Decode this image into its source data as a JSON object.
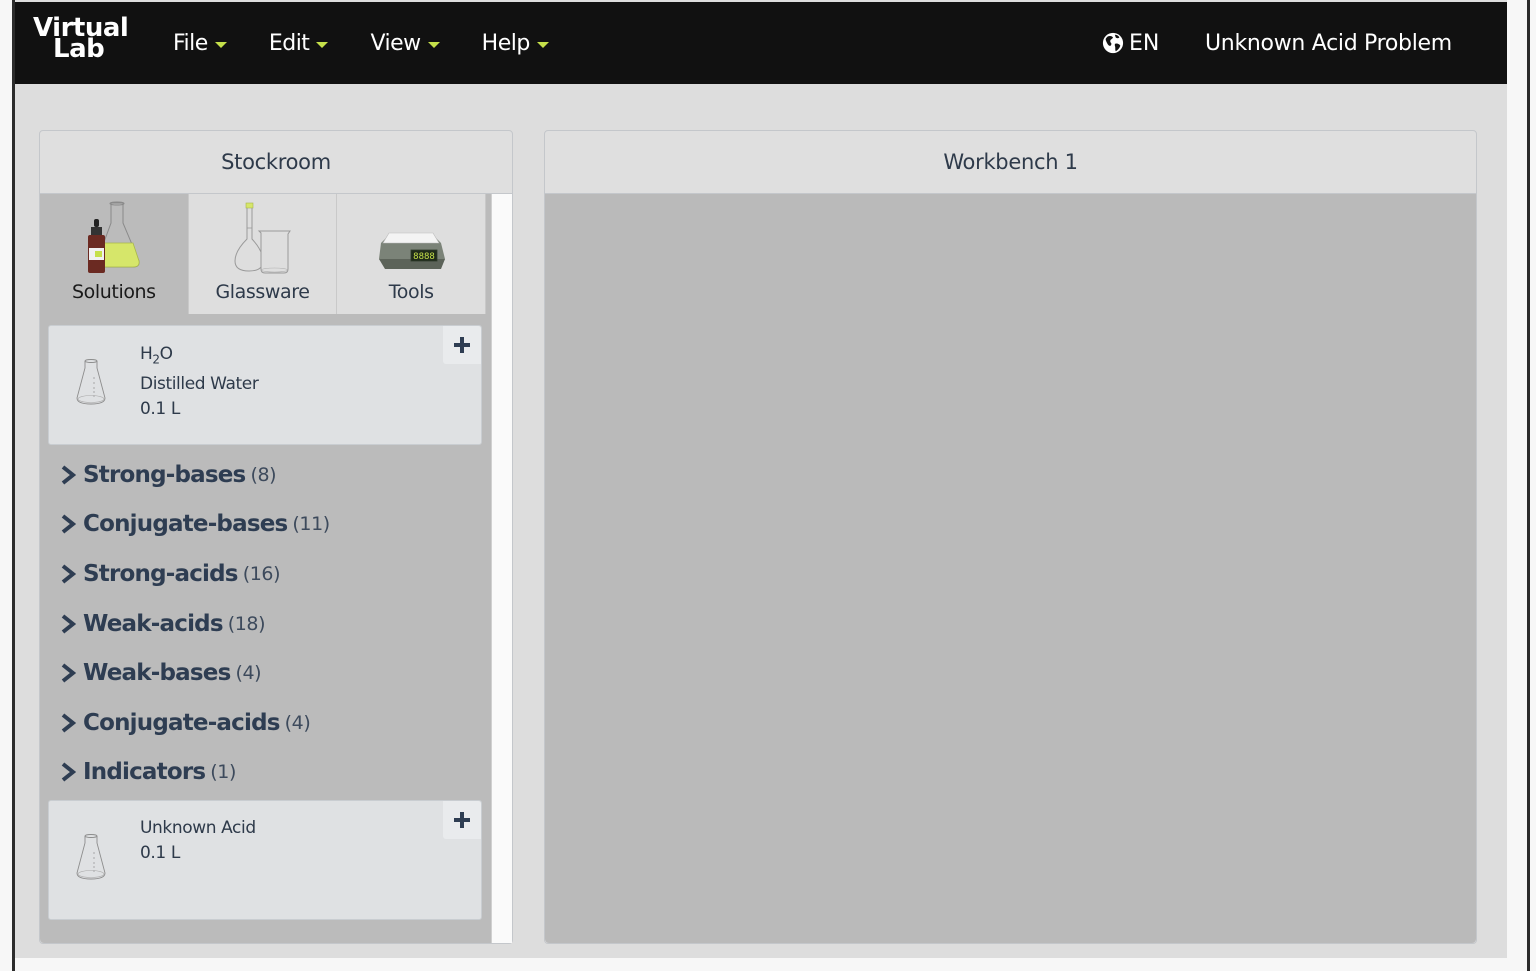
{
  "app": {
    "logo_line1": "Virtual",
    "logo_line2": "Lab",
    "menu": [
      {
        "label": "File"
      },
      {
        "label": "Edit"
      },
      {
        "label": "View"
      },
      {
        "label": "Help"
      }
    ],
    "language": "EN",
    "problem_title": "Unknown Acid Problem"
  },
  "stockroom": {
    "title": "Stockroom",
    "tabs": [
      {
        "label": "Solutions",
        "icon": "solutions-icon",
        "active": true
      },
      {
        "label": "Glassware",
        "icon": "glassware-icon",
        "active": false
      },
      {
        "label": "Tools",
        "icon": "scale-icon",
        "active": false
      }
    ],
    "top_item": {
      "formula_main": "H",
      "formula_sub": "2",
      "formula_end": "O",
      "name": "Distilled Water",
      "volume": "0.1 L"
    },
    "categories": [
      {
        "name": "Strong-bases",
        "count": "(8)"
      },
      {
        "name": "Conjugate-bases",
        "count": "(11)"
      },
      {
        "name": "Strong-acids",
        "count": "(16)"
      },
      {
        "name": "Weak-acids",
        "count": "(18)"
      },
      {
        "name": "Weak-bases",
        "count": "(4)"
      },
      {
        "name": "Conjugate-acids",
        "count": "(4)"
      },
      {
        "name": "Indicators",
        "count": "(1)"
      }
    ],
    "bottom_item": {
      "name": "Unknown Acid",
      "volume": "0.1 L"
    }
  },
  "workbench": {
    "title": "Workbench 1"
  },
  "colors": {
    "topbar": "#111111",
    "caret_accent": "#c5e04a",
    "text_dark": "#2e3d52",
    "workbench_bg": "#bababa"
  }
}
